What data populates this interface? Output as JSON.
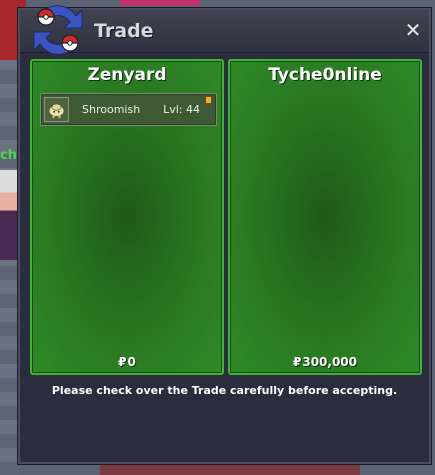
{
  "window": {
    "title": "Trade",
    "close_label": "✕"
  },
  "background": {
    "side_tag": "ch"
  },
  "left_panel": {
    "name": "Zenyard",
    "currency_symbol": "₽",
    "money": "0",
    "items": [
      {
        "name": "Shroomish",
        "level": "Lvl: 44",
        "icon": "shroomish-icon"
      }
    ]
  },
  "right_panel": {
    "name": "Tyche0nline",
    "currency_symbol": "₽",
    "money": "300,000",
    "items": []
  },
  "footer": {
    "message": "Please check over the Trade carefully before accepting."
  },
  "colors": {
    "panel_green": "#2a7a22",
    "panel_border": "#3fb332",
    "window_bg": "#2b2d3f",
    "title_text": "#d6d8df"
  }
}
